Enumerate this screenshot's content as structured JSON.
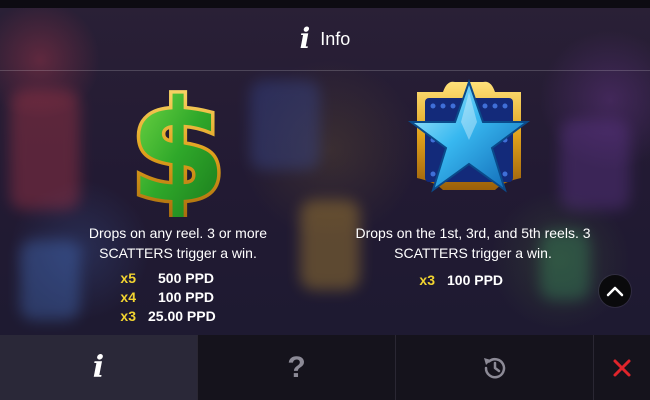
{
  "header": {
    "title": "Info",
    "info_icon": "info-icon"
  },
  "symbols": [
    {
      "icon": "dollar-sign-symbol",
      "description_line1": "Drops on any reel. 3 or more",
      "description_line2": "SCATTERS trigger a win.",
      "payouts": [
        {
          "multiplier": "x5",
          "amount": "500 PPD"
        },
        {
          "multiplier": "x4",
          "amount": "100 PPD"
        },
        {
          "multiplier": "x3",
          "amount": "25.00 PPD"
        }
      ]
    },
    {
      "icon": "star-symbol",
      "description_line1": "Drops on the 1st, 3rd, and 5th reels. 3",
      "description_line2": "SCATTERS trigger a win.",
      "payouts": [
        {
          "multiplier": "x3",
          "amount": "100 PPD"
        }
      ]
    }
  ],
  "nav": {
    "items": [
      {
        "name": "info",
        "icon": "info-icon",
        "active": true
      },
      {
        "name": "help",
        "icon": "question-icon",
        "active": false
      },
      {
        "name": "history",
        "icon": "history-icon",
        "active": false
      },
      {
        "name": "close",
        "icon": "close-icon",
        "active": false
      }
    ]
  },
  "colors": {
    "multiplier": "#f2d430",
    "close": "#e0242b",
    "nav_bg": "#15131c",
    "nav_active_bg": "#2a2838"
  }
}
